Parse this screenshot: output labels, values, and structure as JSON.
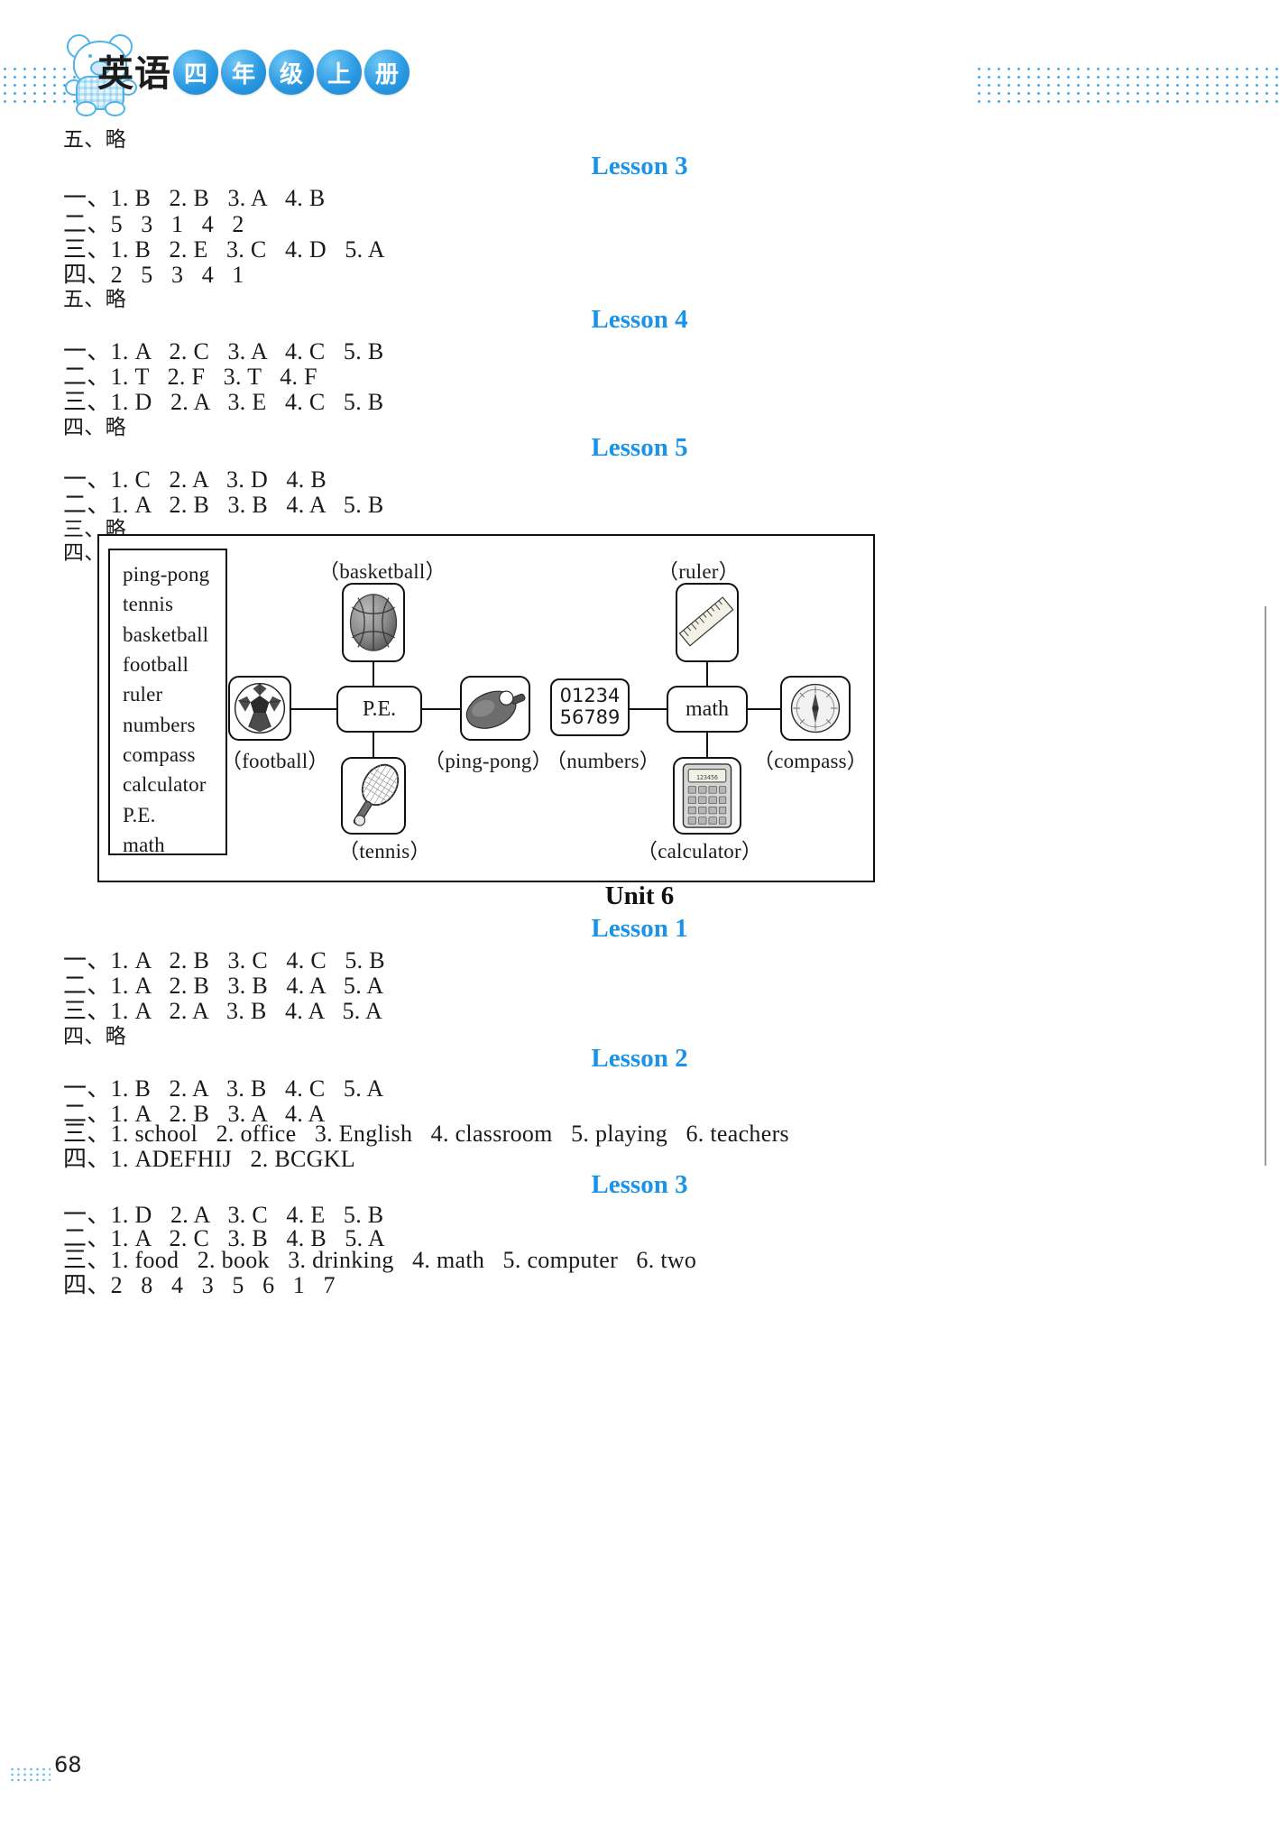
{
  "header": {
    "subject_cn": "英语",
    "grade_badges": [
      "四",
      "年",
      "级",
      "上",
      "册"
    ],
    "bear_icon": "bear-mascot-icon",
    "accent_color": "#1a93e8",
    "badge_color": "#2b9ae3"
  },
  "top_section": {
    "line_five": "五、略"
  },
  "lessons": [
    {
      "id": "unit5-lesson3",
      "heading": "Lesson 3",
      "answers": [
        "一、1. B   2. B   3. A   4. B",
        "二、5   3   1   4   2",
        "三、1. B   2. E   3. C   4. D   5. A",
        "四、2   5   3   4   1",
        "五、略"
      ]
    },
    {
      "id": "unit5-lesson4",
      "heading": "Lesson 4",
      "answers": [
        "一、1. A   2. C   3. A   4. C   5. B",
        "二、1. T   2. F   3. T   4. F",
        "三、1. D   2. A   3. E   4. C   5. B",
        "四、略"
      ]
    },
    {
      "id": "unit5-lesson5",
      "heading": "Lesson 5",
      "answers": [
        "一、1. C   2. A   3. D   4. B",
        "二、1. A   2. B   3. B   4. A   5. B",
        "三、略",
        "四、"
      ]
    }
  ],
  "diagram": {
    "word_list_title": "word-bank",
    "word_list": [
      "ping-pong",
      "tennis",
      "basketball",
      "football",
      "ruler",
      "numbers",
      "compass",
      "calculator",
      "P.E.",
      "math"
    ],
    "nodes": [
      {
        "key": "basketball",
        "label": "（basketball）",
        "content": "",
        "icon": "basketball-icon"
      },
      {
        "key": "ruler",
        "label": "（ruler）",
        "content": "",
        "icon": "ruler-icon"
      },
      {
        "key": "football",
        "label": "（football）",
        "content": "",
        "icon": "soccer-ball-icon"
      },
      {
        "key": "pe",
        "label": "",
        "content": "P.E.",
        "icon": ""
      },
      {
        "key": "pingpong",
        "label": "（ping-pong）",
        "content": "",
        "icon": "ping-pong-paddle-icon"
      },
      {
        "key": "numbers",
        "label": "（numbers）",
        "content": "01234 56789",
        "icon": ""
      },
      {
        "key": "math",
        "label": "",
        "content": "math",
        "icon": ""
      },
      {
        "key": "compass",
        "label": "（compass）",
        "content": "",
        "icon": "compass-icon"
      },
      {
        "key": "tennis",
        "label": "（tennis）",
        "content": "",
        "icon": "tennis-racket-icon"
      },
      {
        "key": "calculator",
        "label": "（calculator）",
        "content": "",
        "icon": "calculator-icon"
      }
    ],
    "numbers_line1": "01234",
    "numbers_line2": "56789",
    "pe_label": "P.E.",
    "math_label": "math"
  },
  "unit6": {
    "heading": "Unit 6",
    "lessons": [
      {
        "id": "unit6-lesson1",
        "heading": "Lesson 1",
        "answers": [
          "一、1. A   2. B   3. C   4. C   5. B",
          "二、1. A   2. B   3. B   4. A   5. A",
          "三、1. A   2. A   3. B   4. A   5. A",
          "四、略"
        ]
      },
      {
        "id": "unit6-lesson2",
        "heading": "Lesson 2",
        "answers": [
          "一、1. B   2. A   3. B   4. C   5. A",
          "二、1. A   2. B   3. A   4. A",
          "三、1. school   2. office   3. English   4. classroom   5. playing   6. teachers",
          "四、1. ADEFHIJ   2. BCGKL"
        ]
      },
      {
        "id": "unit6-lesson3",
        "heading": "Lesson 3",
        "answers": [
          "一、1. D   2. A   3. C   4. E   5. B",
          "二、1. A   2. C   3. B   4. B   5. A",
          "三、1. food   2. book   3. drinking   4. math   5. computer   6. two",
          "四、2   8   4   3   5   6   1   7"
        ]
      }
    ]
  },
  "footer": {
    "page_number": "68"
  }
}
